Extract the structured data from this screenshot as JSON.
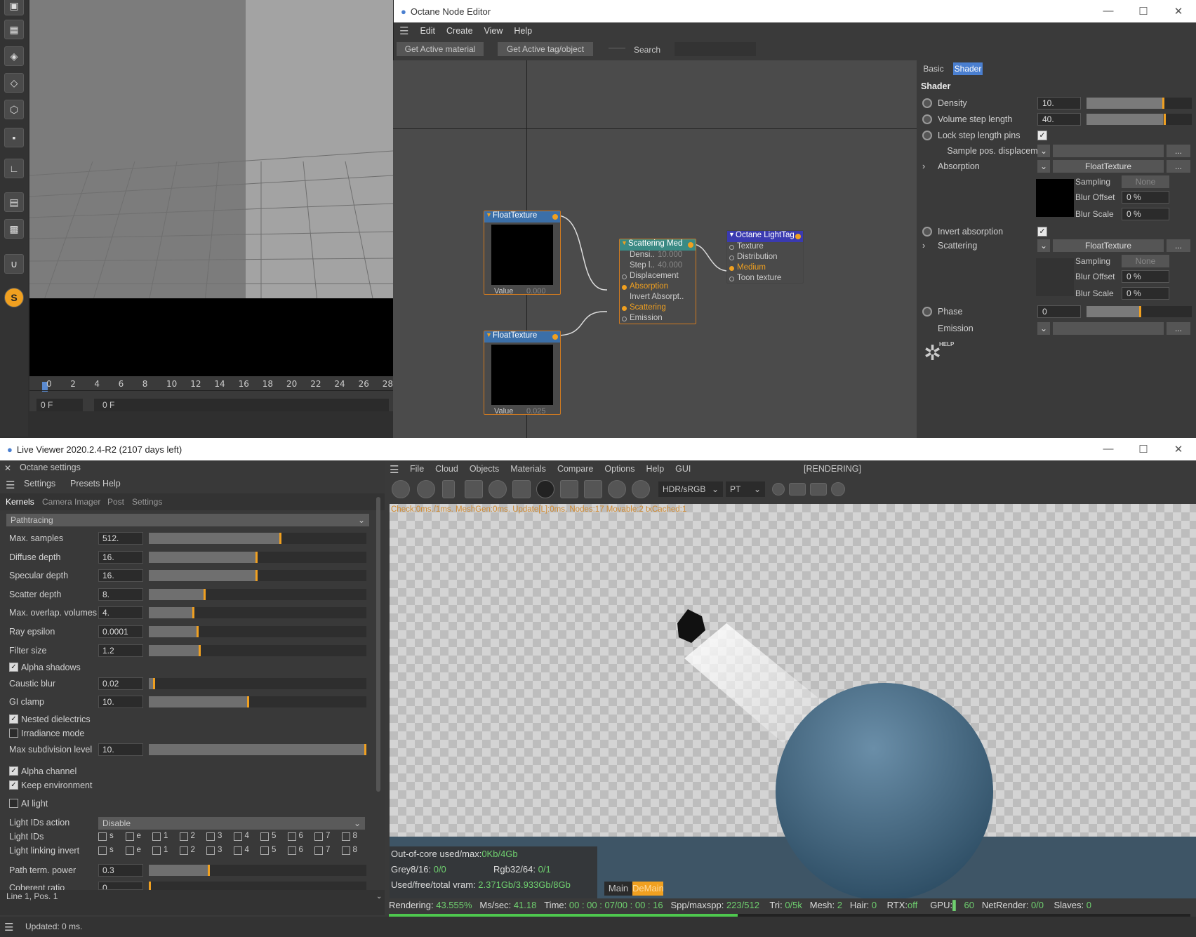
{
  "toolstrip": {
    "icons": [
      "cube-icon",
      "checker-icon",
      "vertex-icon",
      "edge-icon",
      "polygon-icon",
      "texture-icon",
      "axis-icon",
      "grid-icon",
      "workplane-icon",
      "magnet-icon",
      "s-icon"
    ]
  },
  "timeline": {
    "ticks": [
      "0",
      "2",
      "4",
      "6",
      "8",
      "10",
      "12",
      "14",
      "16",
      "18",
      "20",
      "22",
      "24",
      "26",
      "28"
    ],
    "frame_start": "0 F",
    "frame_current": "0 F"
  },
  "node_editor": {
    "title": "Octane Node Editor",
    "menu": [
      "Edit",
      "Create",
      "View",
      "Help"
    ],
    "get_material": "Get Active material",
    "get_tag": "Get Active tag/object",
    "search_label": "Search",
    "search_value": "",
    "nodes": {
      "float1": {
        "title": "FloatTexture",
        "value_label": "Value",
        "value": "0.000"
      },
      "float2": {
        "title": "FloatTexture",
        "value_label": "Value",
        "value": "0.025"
      },
      "scatter": {
        "title": "Scattering Med",
        "rows": [
          {
            "label": "Densi..",
            "value": "10.000"
          },
          {
            "label": "Step l..",
            "value": "40.000"
          }
        ],
        "pins": [
          "Displacement",
          "Absorption",
          "Invert Absorpt..",
          "Scattering",
          "Emission"
        ]
      },
      "light": {
        "title": "Octane LightTag",
        "pins": [
          "Texture",
          "Distribution",
          "Medium",
          "Toon texture"
        ]
      }
    }
  },
  "shader_panel": {
    "tabs": [
      "Basic",
      "Shader"
    ],
    "heading": "Shader",
    "density_label": "Density",
    "density_value": "10.",
    "density_fill": 0.72,
    "step_label": "Volume step length",
    "step_value": "40.",
    "step_fill": 0.73,
    "lock_label": "Lock step length pins",
    "sample_label": "Sample pos. displacement",
    "absorption_label": "Absorption",
    "absorption_tex": "FloatTexture",
    "sampling_label": "Sampling",
    "sampling_value": "None",
    "blur_offset_label": "Blur Offset",
    "blur_offset_value": "0 %",
    "blur_scale_label": "Blur Scale",
    "blur_scale_value": "0 %",
    "invert_label": "Invert absorption",
    "scattering_label": "Scattering",
    "scattering_tex": "FloatTexture",
    "phase_label": "Phase",
    "phase_value": "0",
    "phase_fill": 0.5,
    "emission_label": "Emission",
    "ellipsis": "...",
    "help_label": "HELP"
  },
  "live_viewer": {
    "title": "Live Viewer 2020.2.4-R2 (2107 days left)",
    "settings_title": "Octane settings",
    "settings_menu": [
      "Settings",
      "Presets",
      "Help"
    ],
    "tabs": [
      "Kernels",
      "Camera Imager",
      "Post",
      "Settings"
    ],
    "kernel": "Pathtracing",
    "rows": [
      {
        "label": "Max. samples",
        "value": "512.",
        "fill": 0.6
      },
      {
        "label": "Diffuse depth",
        "value": "16.",
        "fill": 0.49
      },
      {
        "label": "Specular depth",
        "value": "16.",
        "fill": 0.49
      },
      {
        "label": "Scatter depth",
        "value": "8.",
        "fill": 0.25
      },
      {
        "label": "Max. overlap. volumes",
        "value": "4.",
        "fill": 0.2
      },
      {
        "label": "Ray epsilon",
        "value": "0.0001",
        "fill": 0.22
      },
      {
        "label": "Filter size",
        "value": "1.2",
        "fill": 0.23
      }
    ],
    "alpha_shadows": "Alpha shadows",
    "caustic_label": "Caustic blur",
    "caustic_value": "0.02",
    "caustic_fill": 0.02,
    "gi_label": "GI clamp",
    "gi_value": "10.",
    "gi_fill": 0.45,
    "nested": "Nested dielectrics",
    "irradiance": "Irradiance mode",
    "maxsub_label": "Max subdivision level",
    "maxsub_value": "10.",
    "maxsub_fill": 1.0,
    "alpha_channel": "Alpha channel",
    "keep_env": "Keep environment",
    "ai_light": "AI light",
    "light_ids_action_label": "Light IDs action",
    "light_ids_action": "Disable",
    "light_ids_label": "Light IDs",
    "light_link_label": "Light linking invert",
    "id_items": [
      "s",
      "e",
      "1",
      "2",
      "3",
      "4",
      "5",
      "6",
      "7",
      "8"
    ],
    "pathterm_label": "Path term. power",
    "pathterm_value": "0.3",
    "pathterm_fill": 0.27,
    "coherent_label": "Coherent ratio",
    "coherent_value": "0",
    "coherent_fill": 0.0,
    "line_pos": "Line 1, Pos. 1",
    "updated": "Updated: 0 ms."
  },
  "render": {
    "menu": [
      "File",
      "Cloud",
      "Objects",
      "Materials",
      "Compare",
      "Options",
      "Help",
      "GUI"
    ],
    "status": "[RENDERING]",
    "color_space": "HDR/sRGB",
    "kernel_short": "PT",
    "debug_line": "Check:0ms./1ms. MeshGen:0ms. Update[L]:0ms. Nodes:17 Movable:2 txCached:1",
    "ooc_label": "Out-of-core used/max:",
    "ooc_value": "0Kb/4Gb",
    "grey_label": "Grey8/16:",
    "grey_value": "0/0",
    "rgb_label": "Rgb32/64:",
    "rgb_value": "0/1",
    "vram_label": "Used/free/total vram:",
    "vram_value": "2.371Gb/3.933Gb/8Gb",
    "tab_main": "Main",
    "tab_demain": "DeMain",
    "rendering_label": "Rendering:",
    "rendering_value": "43.555%",
    "progress": 0.4356,
    "ms_label": "Ms/sec:",
    "ms_value": "41.18",
    "time_label": "Time:",
    "time_value": "00 : 00 : 07/00 : 00 : 16",
    "spp_label": "Spp/maxspp:",
    "spp_value": "223/512",
    "tri_label": "Tri:",
    "tri_value": "0/5k",
    "mesh_label": "Mesh:",
    "mesh_value": "2",
    "hair_label": "Hair:",
    "hair_value": "0",
    "rtx_label": "RTX:",
    "rtx_value": "off",
    "gpu_label": "GPU:",
    "gpu_value": "60",
    "net_label": "NetRender:",
    "net_value": "0/0",
    "slaves_label": "Slaves:",
    "slaves_value": "0"
  },
  "colors": {
    "accent": "#f0a020",
    "node_border": "#d07a20",
    "tab_active": "#4a7fd0",
    "green": "#6fd06f"
  }
}
